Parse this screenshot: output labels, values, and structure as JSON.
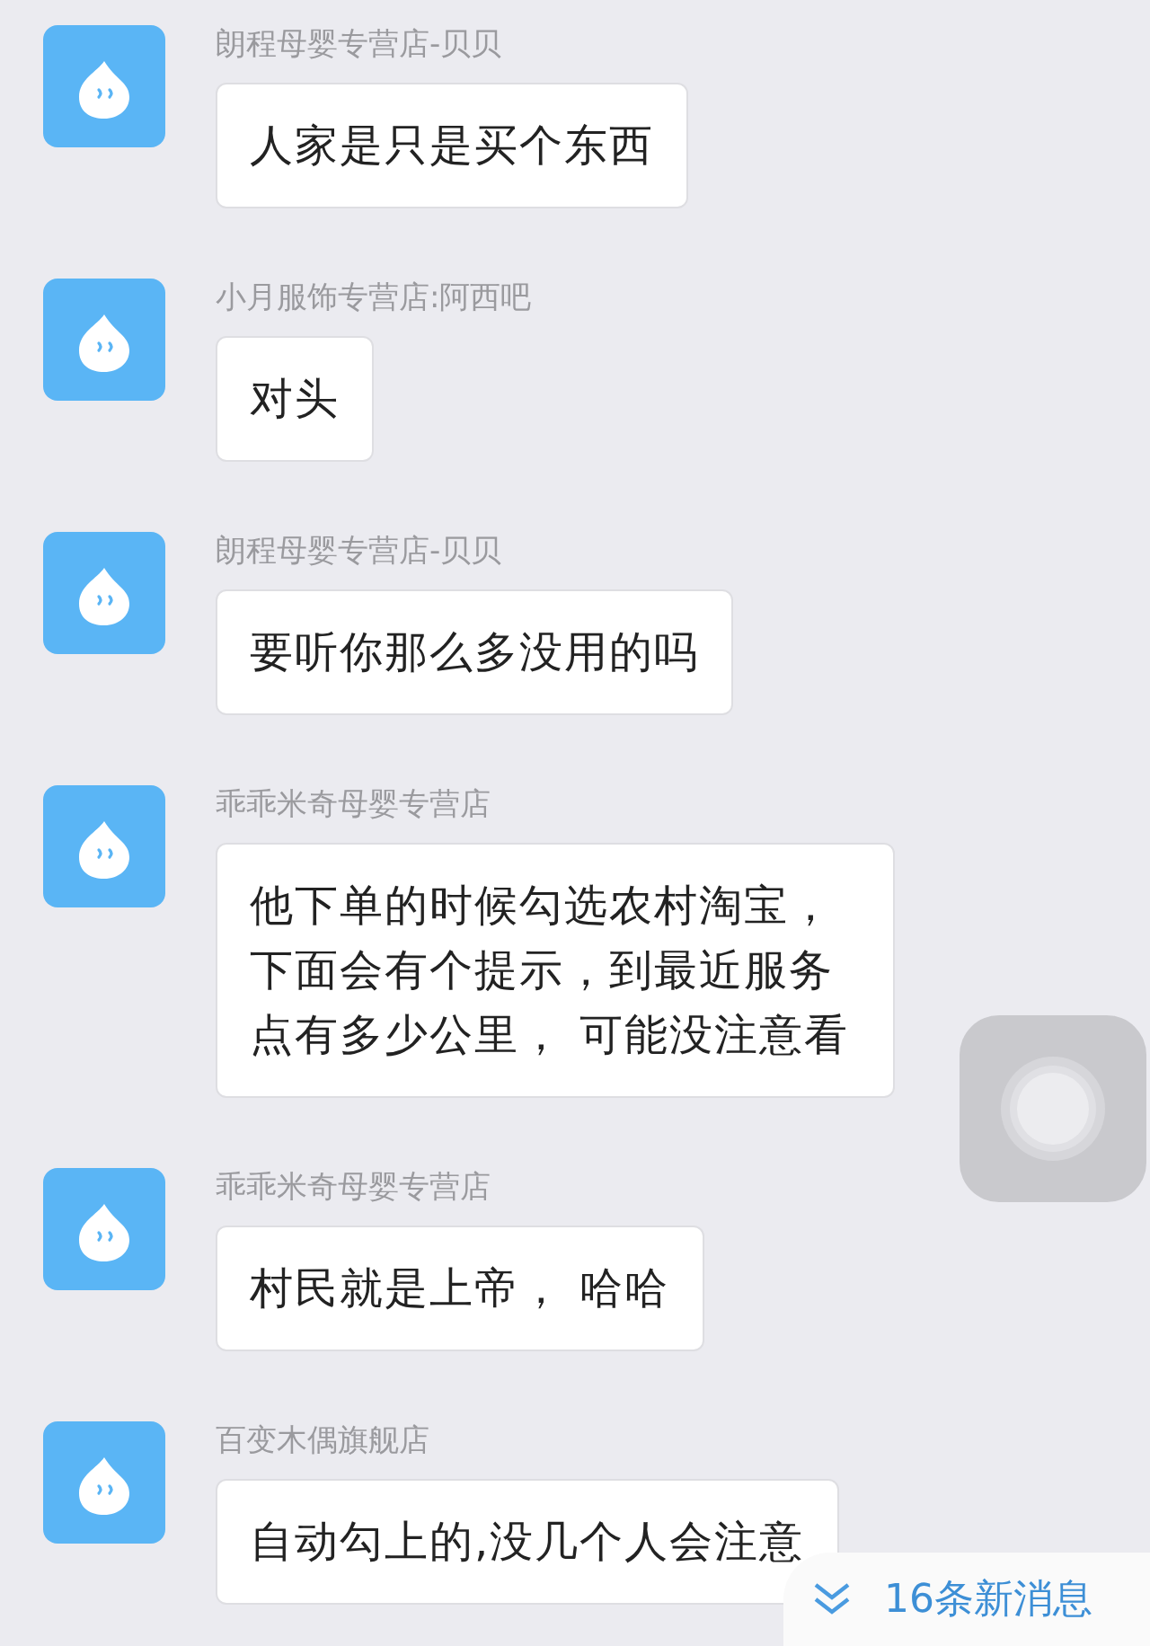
{
  "messages": [
    {
      "sender": "朗程母婴专营店-贝贝",
      "text": "人家是只是买个东西"
    },
    {
      "sender": "小月服饰专营店:阿西吧",
      "text": "对头"
    },
    {
      "sender": "朗程母婴专营店-贝贝",
      "text": "要听你那么多没用的吗"
    },
    {
      "sender": "乖乖米奇母婴专营店",
      "text": "他下单的时候勾选农村淘宝，下面会有个提示，到最近服务点有多少公里， 可能没注意看"
    },
    {
      "sender": "乖乖米奇母婴专营店",
      "text": "村民就是上帝，  哈哈"
    },
    {
      "sender": "百变木偶旗舰店",
      "text": "自动勾上的,没几个人会注意"
    }
  ],
  "new_messages": {
    "label": "16条新消息"
  }
}
